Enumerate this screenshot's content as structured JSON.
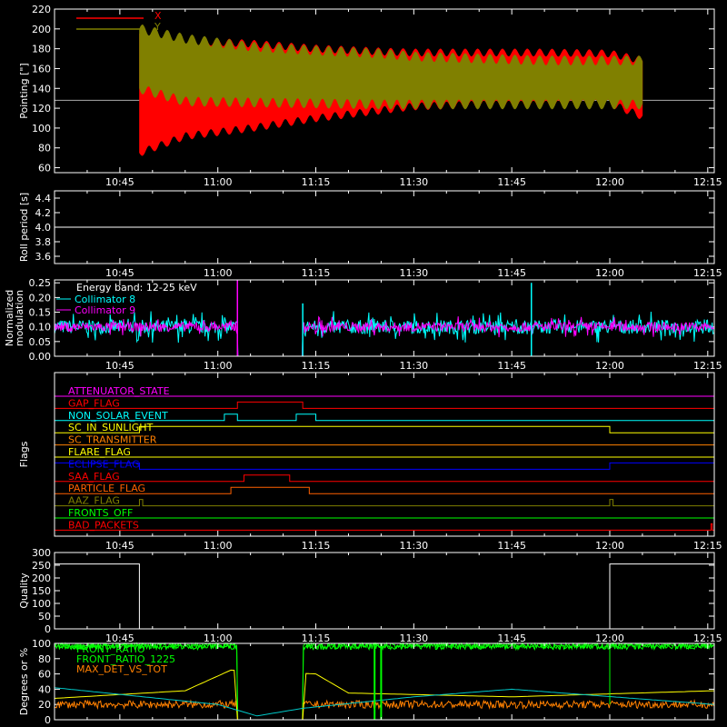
{
  "chart_data": [
    {
      "type": "line",
      "title": "",
      "ylabel": "Pointing [\"]",
      "xlim": [
        "10:35",
        "12:16"
      ],
      "ylim": [
        55,
        220
      ],
      "yticks": [
        60,
        80,
        100,
        120,
        140,
        160,
        180,
        200,
        220
      ],
      "xticks": [
        "10:45",
        "11:00",
        "11:15",
        "11:30",
        "11:45",
        "12:00",
        "12:15"
      ],
      "legend_position": "top-left",
      "reference_line": 128,
      "series": [
        {
          "name": "X",
          "color": "#ff0000",
          "t_start": "10:48",
          "t_end": "12:05",
          "x": [
            "10:48",
            "10:55",
            "11:05",
            "11:15",
            "11:25",
            "11:30",
            "11:40",
            "11:50",
            "12:00",
            "12:05"
          ],
          "min": [
            75,
            92,
            100,
            110,
            118,
            122,
            124,
            124,
            125,
            112
          ],
          "max": [
            195,
            188,
            185,
            180,
            177,
            176,
            176,
            176,
            175,
            168
          ]
        },
        {
          "name": "Y",
          "color": "#808000",
          "t_start": "10:48",
          "t_end": "12:05",
          "x": [
            "10:48",
            "10:55",
            "11:05",
            "11:15",
            "11:25",
            "11:30",
            "11:40",
            "11:50",
            "12:00",
            "12:05"
          ],
          "min": [
            140,
            127,
            126,
            125,
            124,
            124,
            124,
            124,
            124,
            124
          ],
          "max": [
            200,
            190,
            182,
            178,
            175,
            172,
            170,
            168,
            168,
            168
          ]
        }
      ]
    },
    {
      "type": "line",
      "ylabel": "Roll period [s]",
      "ylim": [
        3.5,
        4.5
      ],
      "yticks": [
        "3.6",
        "3.8",
        "4.0",
        "4.2",
        "4.4"
      ],
      "xticks": [
        "10:45",
        "11:00",
        "11:15",
        "11:30",
        "11:45",
        "12:00",
        "12:15"
      ],
      "series": [
        {
          "name": "",
          "color": "#ffffff",
          "x": [
            "10:35",
            "12:16"
          ],
          "values": [
            4.0,
            4.0
          ]
        }
      ]
    },
    {
      "type": "line",
      "ylabel": "Normalized modulation",
      "ylim": [
        0,
        0.26
      ],
      "yticks": [
        "0.00",
        "0.05",
        "0.10",
        "0.15",
        "0.20",
        "0.25"
      ],
      "xticks": [
        "10:45",
        "11:00",
        "11:15",
        "11:30",
        "11:45",
        "12:00",
        "12:15"
      ],
      "annotation": "Energy band: 12-25 keV",
      "legend_position": "top-left",
      "gap": [
        "11:03",
        "11:13"
      ],
      "spikes": [
        {
          "series": "Collimator 9",
          "x": "11:03",
          "value": 0.26
        },
        {
          "series": "Collimator 8",
          "x": "11:13",
          "value": 0.18
        },
        {
          "series": "Collimator 8",
          "x": "11:48",
          "value": 0.25
        }
      ],
      "series": [
        {
          "name": "Collimator 8",
          "color": "#00ffff",
          "mean": 0.1,
          "spread": 0.03
        },
        {
          "name": "Collimator 9",
          "color": "#ff00ff",
          "mean": 0.1,
          "spread": 0.02
        }
      ]
    },
    {
      "type": "line",
      "ylabel": "Flags",
      "xticks": [
        "10:45",
        "11:00",
        "11:15",
        "11:30",
        "11:45",
        "12:00",
        "12:15"
      ],
      "series": [
        {
          "name": "ATTENUATOR_STATE",
          "color": "#ff00ff",
          "high": []
        },
        {
          "name": "GAP_FLAG",
          "color": "#ff0000",
          "high": [
            [
              "11:03",
              "11:13"
            ]
          ]
        },
        {
          "name": "NON_SOLAR_EVENT",
          "color": "#00ffff",
          "high": [
            [
              "11:01",
              "11:03"
            ],
            [
              "11:12",
              "11:15"
            ]
          ]
        },
        {
          "name": "SC_IN_SUNLIGHT",
          "color": "#ffff00",
          "high": [
            [
              "10:48",
              "12:00"
            ]
          ]
        },
        {
          "name": "SC_TRANSMITTER",
          "color": "#ff8000",
          "high": []
        },
        {
          "name": "FLARE_FLAG",
          "color": "#ffff00",
          "high": []
        },
        {
          "name": "ECLIPSE_FLAG",
          "color": "#0000ff",
          "high": [
            [
              "10:35",
              "10:48"
            ],
            [
              "12:00",
              "12:16"
            ]
          ]
        },
        {
          "name": "SAA_FLAG",
          "color": "#ff0000",
          "high": [
            [
              "11:04",
              "11:11"
            ]
          ]
        },
        {
          "name": "PARTICLE_FLAG",
          "color": "#ff6000",
          "high": [
            [
              "11:02",
              "11:14"
            ]
          ]
        },
        {
          "name": "AAZ_FLAG",
          "color": "#808000",
          "high": [
            [
              "10:48",
              "10:48.5"
            ],
            [
              "12:00",
              "12:00.5"
            ]
          ]
        },
        {
          "name": "FRONTS_OFF",
          "color": "#00ff00",
          "high": []
        },
        {
          "name": "BAD_PACKETS",
          "color": "#ff0000",
          "high": [
            [
              "12:15.5",
              "12:15.7"
            ]
          ]
        }
      ]
    },
    {
      "type": "line",
      "ylabel": "Quality",
      "ylim": [
        0,
        300
      ],
      "yticks": [
        0,
        50,
        100,
        150,
        200,
        250,
        300
      ],
      "xticks": [
        "10:45",
        "11:00",
        "11:15",
        "11:30",
        "11:45",
        "12:00",
        "12:15"
      ],
      "series": [
        {
          "name": "",
          "color": "#ffffff",
          "x": [
            "10:35",
            "10:48",
            "10:48",
            "12:00",
            "12:00",
            "12:16"
          ],
          "values": [
            255,
            255,
            0,
            0,
            255,
            255
          ]
        }
      ]
    },
    {
      "type": "line",
      "ylabel": "Degrees or %",
      "ylim": [
        0,
        100
      ],
      "yticks": [
        0,
        20,
        40,
        60,
        80,
        100
      ],
      "legend_position": "top-left",
      "gap": [
        "11:03",
        "11:13"
      ],
      "series": [
        {
          "name": "FRONT_RATIO",
          "color": "#00ff00",
          "mean": 96
        },
        {
          "name": "FRONT_RATIO_1225",
          "color": "#00ff00",
          "mean": 97
        },
        {
          "name": "MAX_DET_VS_TOT",
          "color": "#ff8000",
          "mean": 20
        },
        {
          "name": "",
          "color": "#ffff00",
          "x": [
            "10:35",
            "10:55",
            "11:02",
            "11:15",
            "11:20",
            "11:45",
            "12:16"
          ],
          "values": [
            28,
            38,
            65,
            60,
            35,
            30,
            38
          ]
        },
        {
          "name": "",
          "color": "#00c8c8",
          "x": [
            "10:35",
            "11:00",
            "11:06",
            "11:13",
            "11:30",
            "11:45",
            "12:16"
          ],
          "values": [
            42,
            20,
            5,
            15,
            30,
            40,
            20
          ]
        }
      ]
    }
  ]
}
